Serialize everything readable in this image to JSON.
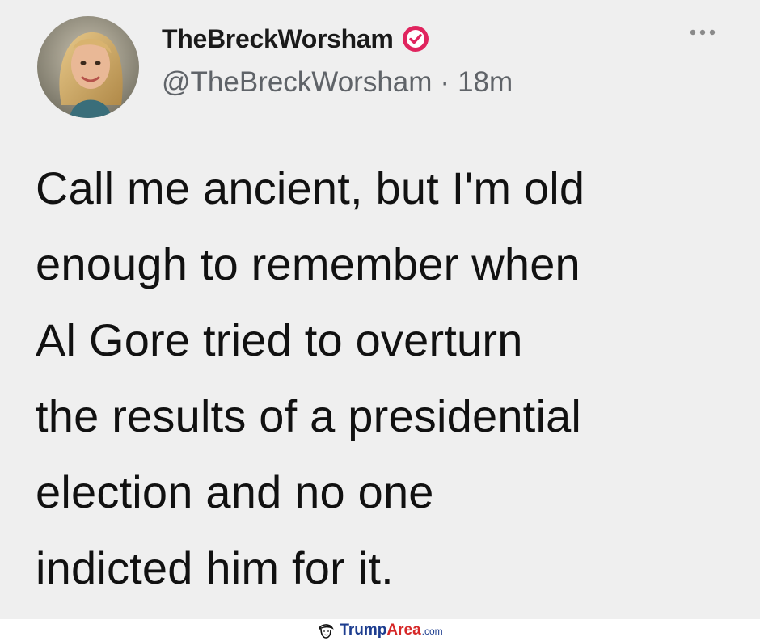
{
  "tweet": {
    "display_name": "TheBreckWorsham",
    "handle": "@TheBreckWorsham",
    "separator": "·",
    "timestamp": "18m",
    "text": "Call me ancient, but I'm old\nenough to remember when\nAl Gore tried to overturn\nthe results of a presidential\nelection and no one\nindicted him for it.",
    "verified_badge_color": "#e0245e",
    "avatar_icon": "profile-photo",
    "more_icon": "ellipsis-icon"
  },
  "watermark": {
    "part1": "Trump",
    "part2": "Area",
    "part3": ".com",
    "icon": "trump-face-icon"
  },
  "colors": {
    "card_background": "#efefef",
    "text_primary": "#111111",
    "text_secondary": "#5f6368"
  }
}
